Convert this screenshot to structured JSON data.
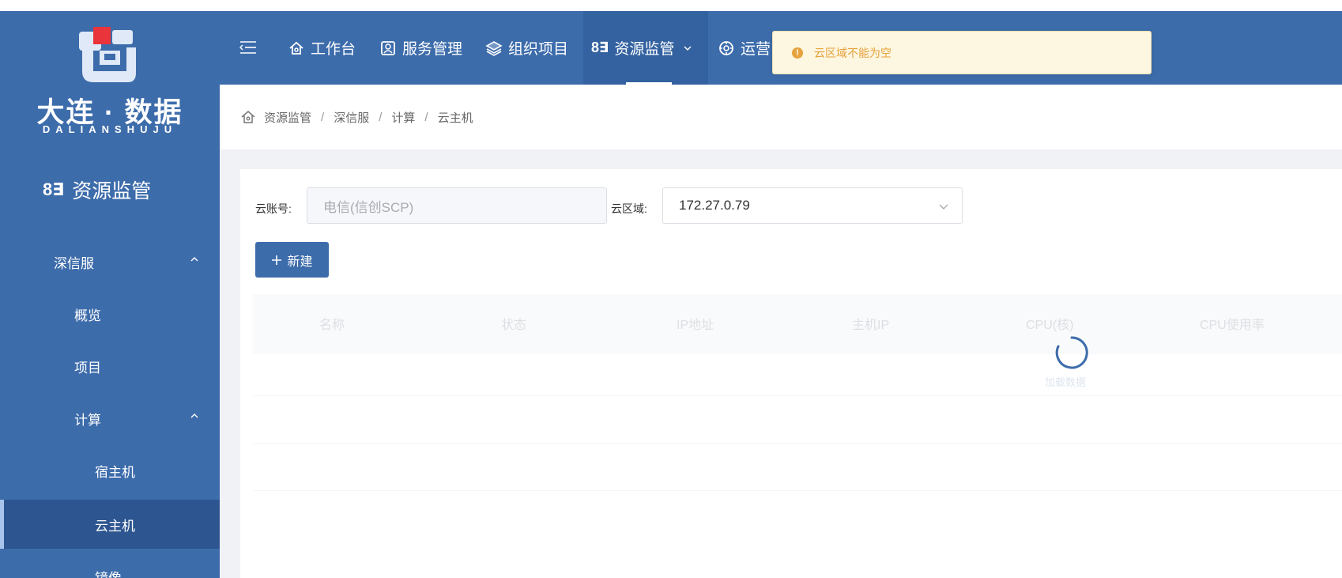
{
  "brand": {
    "title": "大连 · 数据",
    "subtitle": "DALIANSHUJU"
  },
  "sidebar": {
    "module_glyph": "8∃",
    "module_title": "资源监管",
    "items": [
      {
        "label": "深信服",
        "level": 1,
        "expanded": true
      },
      {
        "label": "概览",
        "level": 2
      },
      {
        "label": "项目",
        "level": 2
      },
      {
        "label": "计算",
        "level": 2,
        "expanded": true
      },
      {
        "label": "宿主机",
        "level": 3
      },
      {
        "label": "云主机",
        "level": 3,
        "active": true
      },
      {
        "label": "镜像",
        "level": 3
      }
    ]
  },
  "topnav": {
    "items": [
      {
        "label": "工作台",
        "icon": "home-icon"
      },
      {
        "label": "服务管理",
        "icon": "id-card-icon"
      },
      {
        "label": "组织项目",
        "icon": "layers-icon"
      },
      {
        "label": "资源监管",
        "icon": "monitor-glyph-icon",
        "glyph": "8∃",
        "active": true
      },
      {
        "label": "运营",
        "icon": "gear-icon"
      }
    ]
  },
  "toast": {
    "icon": "warning-icon",
    "message": "云区域不能为空"
  },
  "breadcrumb": [
    "资源监管",
    "深信服",
    "计算",
    "云主机"
  ],
  "filters": {
    "account_label": "云账号:",
    "account_placeholder": "电信(信创SCP)",
    "region_label": "云区域:",
    "region_value": "172.27.0.79"
  },
  "actions": {
    "new_label": "新建"
  },
  "table": {
    "columns": [
      "名称",
      "状态",
      "IP地址",
      "主机IP",
      "CPU(核)",
      "CPU使用率"
    ],
    "loading_text": "加载数据"
  },
  "colors": {
    "primary": "#3d6cab",
    "active_bg": "#2d5590",
    "warning": "#e6a23c",
    "warning_bg": "#fdf6e0"
  }
}
